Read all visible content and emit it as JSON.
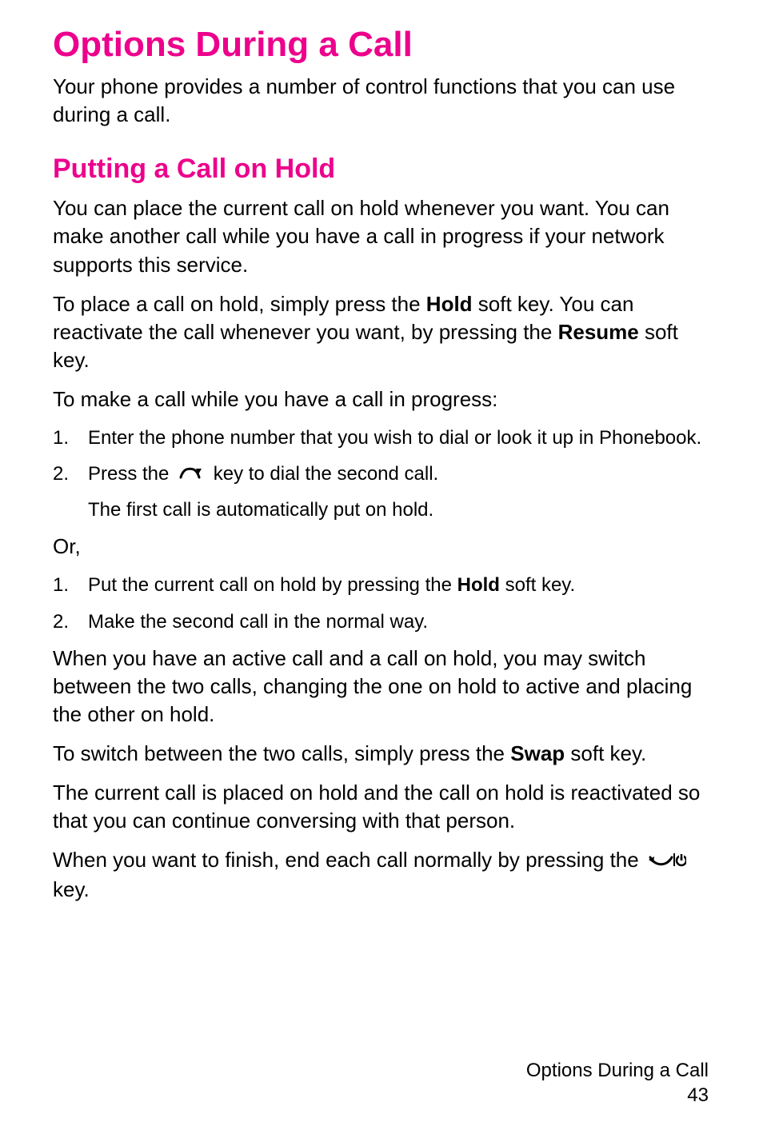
{
  "icons": {
    "send_key": "send-key-icon",
    "end_key": "end-power-key-icon"
  },
  "heading_main": "Options During a Call",
  "intro": "Your phone provides a number of control functions that you can use during a call.",
  "heading_section": "Putting a Call on Hold",
  "p1": "You can place the current call on hold whenever you want. You can make another call while you have a call in progress if your network supports this service.",
  "p2_pre": "To place a call on hold, simply press the ",
  "p2_bold1": "Hold",
  "p2_mid": " soft key. You can reactivate the call whenever you want, by pressing the ",
  "p2_bold2": "Resume",
  "p2_post": " soft key.",
  "p3": "To make a call while you have a call in progress:",
  "list1": [
    {
      "num": "1.",
      "text": "Enter the phone number that you wish to dial or look it up in Phonebook."
    },
    {
      "num": "2.",
      "pre": "Press the ",
      "icon": "send",
      "post": " key to dial the second call."
    }
  ],
  "list1_sub": "The first call is automatically put on hold.",
  "p_or": "Or,",
  "list2": [
    {
      "num": "1.",
      "pre": "Put the current call on hold by pressing the ",
      "bold": "Hold",
      "post": " soft key."
    },
    {
      "num": "2.",
      "text": "Make the second call in the normal way."
    }
  ],
  "p5": "When you have an active call and a call on hold, you may switch between the two calls, changing the one on hold to active and placing the other on hold.",
  "p6_pre": "To switch between the two calls, simply press the ",
  "p6_bold": "Swap",
  "p6_post": " soft key.",
  "p7": "The current call is placed on hold and the call on hold is reactivated so that you can continue conversing with that person.",
  "p8_pre": "When you want to finish, end each call normally by pressing the ",
  "p8_post": " key.",
  "footer_title": "Options During a Call",
  "footer_page": "43"
}
